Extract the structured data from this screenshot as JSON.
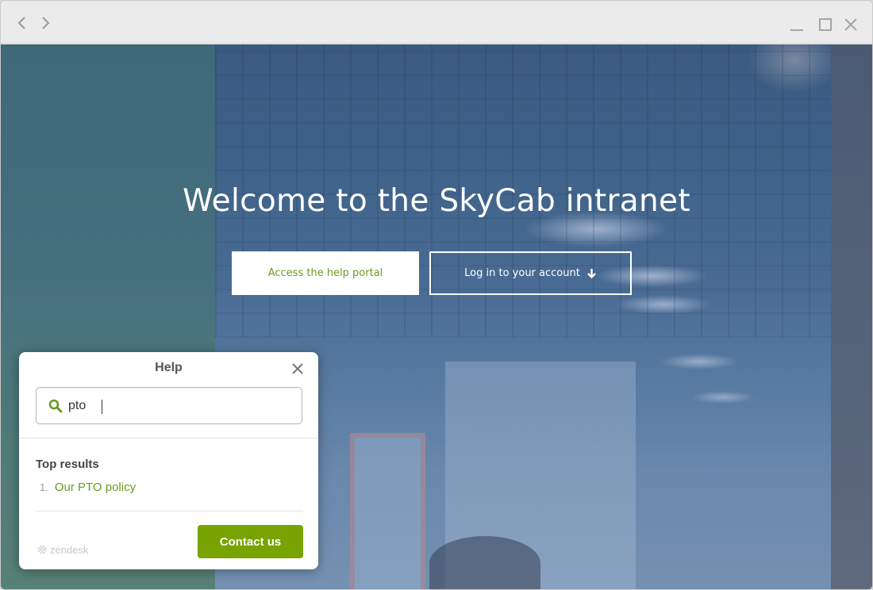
{
  "browser": {
    "back_icon": "chevron-left-icon",
    "forward_icon": "chevron-right-icon",
    "minimize_icon": "minimize-icon",
    "maximize_icon": "maximize-icon",
    "close_icon": "close-icon"
  },
  "hero": {
    "title": "Welcome to the SkyCab intranet",
    "help_portal_label": "Access the help portal",
    "login_label": "Log in to your account",
    "login_icon": "arrow-down-icon"
  },
  "help_widget": {
    "title": "Help",
    "search_value": "pto",
    "results_heading": "Top results",
    "results": [
      {
        "number": "1.",
        "label": "Our PTO policy"
      }
    ],
    "contact_label": "Contact us",
    "brand": "zendesk"
  },
  "colors": {
    "accent_green": "#78a300",
    "link_green": "#6a9a1f",
    "hero_blue": "#3e6289"
  }
}
